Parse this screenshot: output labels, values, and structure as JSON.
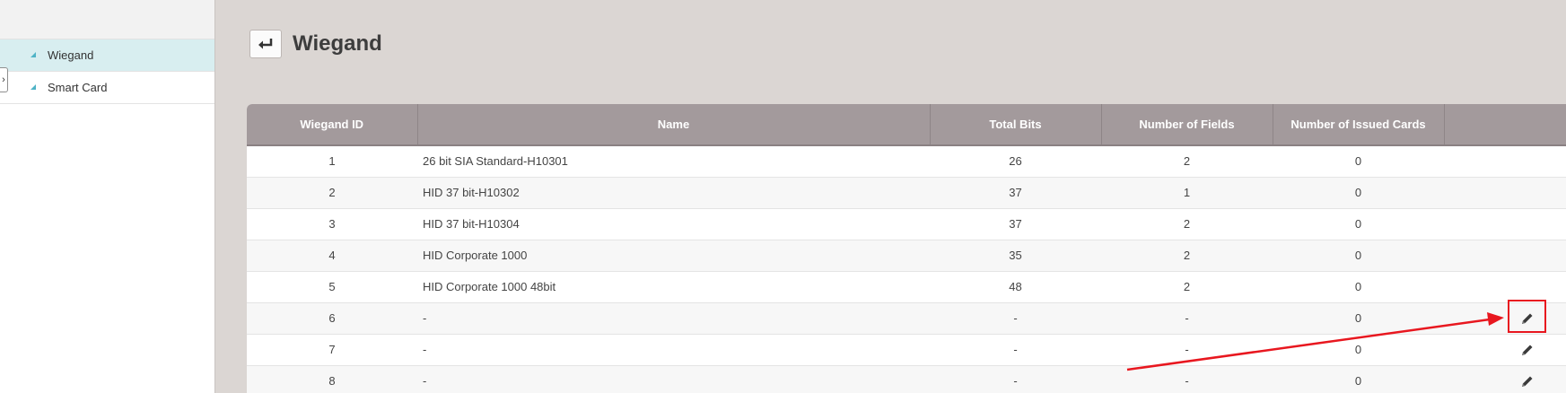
{
  "sidebar": {
    "collapse_icon": "chevron-right-icon",
    "items": [
      {
        "label": "Wiegand",
        "active": true
      },
      {
        "label": "Smart Card",
        "active": false
      }
    ]
  },
  "header": {
    "back_icon": "return-arrow-icon",
    "title": "Wiegand"
  },
  "table": {
    "columns": [
      "Wiegand ID",
      "Name",
      "Total Bits",
      "Number of Fields",
      "Number of Issued Cards",
      ""
    ],
    "rows": [
      {
        "id": "1",
        "name": "26 bit SIA Standard-H10301",
        "total_bits": "26",
        "fields": "2",
        "issued": "0",
        "editable": false
      },
      {
        "id": "2",
        "name": "HID 37 bit-H10302",
        "total_bits": "37",
        "fields": "1",
        "issued": "0",
        "editable": false
      },
      {
        "id": "3",
        "name": "HID 37 bit-H10304",
        "total_bits": "37",
        "fields": "2",
        "issued": "0",
        "editable": false
      },
      {
        "id": "4",
        "name": "HID Corporate 1000",
        "total_bits": "35",
        "fields": "2",
        "issued": "0",
        "editable": false
      },
      {
        "id": "5",
        "name": "HID Corporate 1000 48bit",
        "total_bits": "48",
        "fields": "2",
        "issued": "0",
        "editable": false
      },
      {
        "id": "6",
        "name": "-",
        "total_bits": "-",
        "fields": "-",
        "issued": "0",
        "editable": true
      },
      {
        "id": "7",
        "name": "-",
        "total_bits": "-",
        "fields": "-",
        "issued": "0",
        "editable": true
      },
      {
        "id": "8",
        "name": "-",
        "total_bits": "-",
        "fields": "-",
        "issued": "0",
        "editable": true
      }
    ],
    "edit_icon": "pencil-icon"
  },
  "annotation": {
    "color": "#e8171f"
  }
}
